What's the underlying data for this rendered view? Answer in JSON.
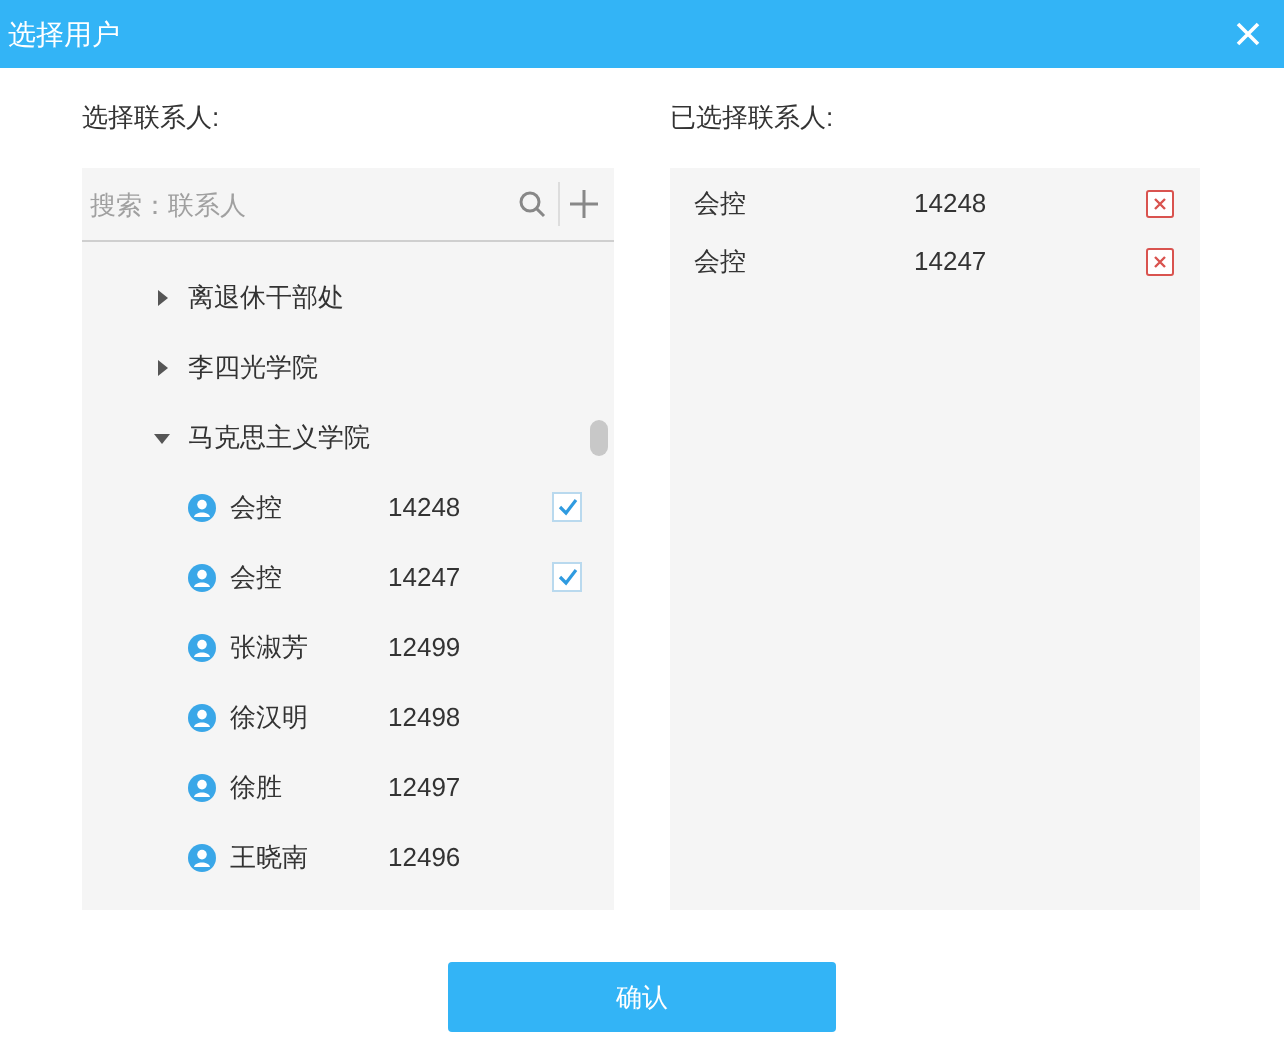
{
  "window": {
    "title": "选择用户"
  },
  "left": {
    "label": "选择联系人:",
    "search": {
      "placeholder": "搜索：联系人"
    },
    "tree": [
      {
        "name": "离退休干部处",
        "expanded": false
      },
      {
        "name": "李四光学院",
        "expanded": false
      },
      {
        "name": "马克思主义学院",
        "expanded": true,
        "children": [
          {
            "name": "会控",
            "id": "14248",
            "checked": true
          },
          {
            "name": "会控",
            "id": "14247",
            "checked": true
          },
          {
            "name": "张淑芳",
            "id": "12499",
            "checked": false
          },
          {
            "name": "徐汉明",
            "id": "12498",
            "checked": false
          },
          {
            "name": "徐胜",
            "id": "12497",
            "checked": false
          },
          {
            "name": "王晓南",
            "id": "12496",
            "checked": false
          }
        ]
      }
    ]
  },
  "right": {
    "label": "已选择联系人:",
    "selected": [
      {
        "name": "会控",
        "id": "14248"
      },
      {
        "name": "会控",
        "id": "14247"
      }
    ]
  },
  "confirm_button": "确认"
}
